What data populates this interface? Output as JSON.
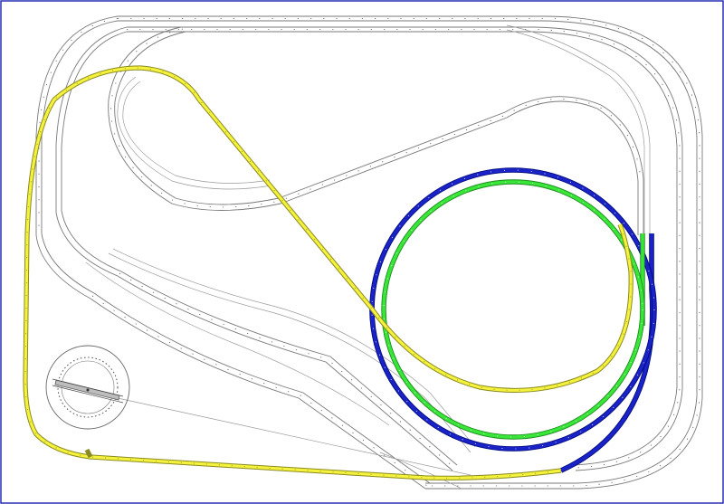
{
  "plan": {
    "border_color": "#1a1fb0",
    "track_colors": {
      "yellow": "#f4f23c",
      "blue": "#1a23c8",
      "green": "#37e637",
      "grey": "#7a7a7a"
    },
    "turntable": {
      "icon": "turntable-icon"
    }
  }
}
